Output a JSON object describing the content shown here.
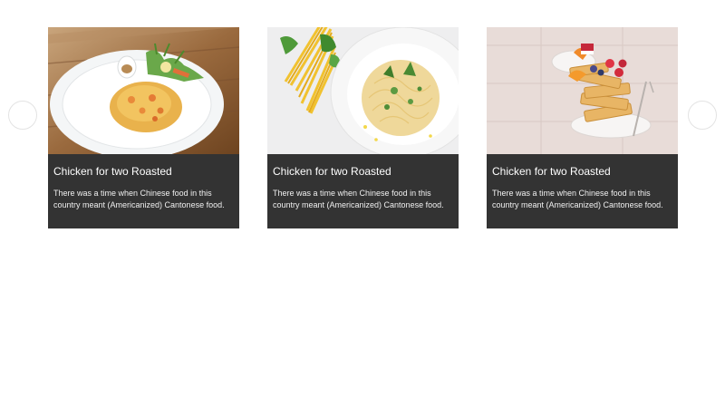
{
  "carousel": {
    "prev_icon": "chevron-left-icon",
    "next_icon": "chevron-right-icon",
    "cards": [
      {
        "title": "Chicken for two Roasted",
        "description": "There was a time when Chinese food in this country meant (Americanized) Cantonese food.",
        "image": "pad-thai-omelette-plate"
      },
      {
        "title": "Chicken for two Roasted",
        "description": "There was a time when Chinese food in this country meant (Americanized) Cantonese food.",
        "image": "spaghetti-plate"
      },
      {
        "title": "Chicken for two Roasted",
        "description": "There was a time when Chinese food in this country meant (Americanized) Cantonese food.",
        "image": "waffles-with-berries"
      }
    ]
  },
  "colors": {
    "card_background": "#333333",
    "card_text": "#ffffff",
    "nav_border": "#e3e3e3"
  }
}
